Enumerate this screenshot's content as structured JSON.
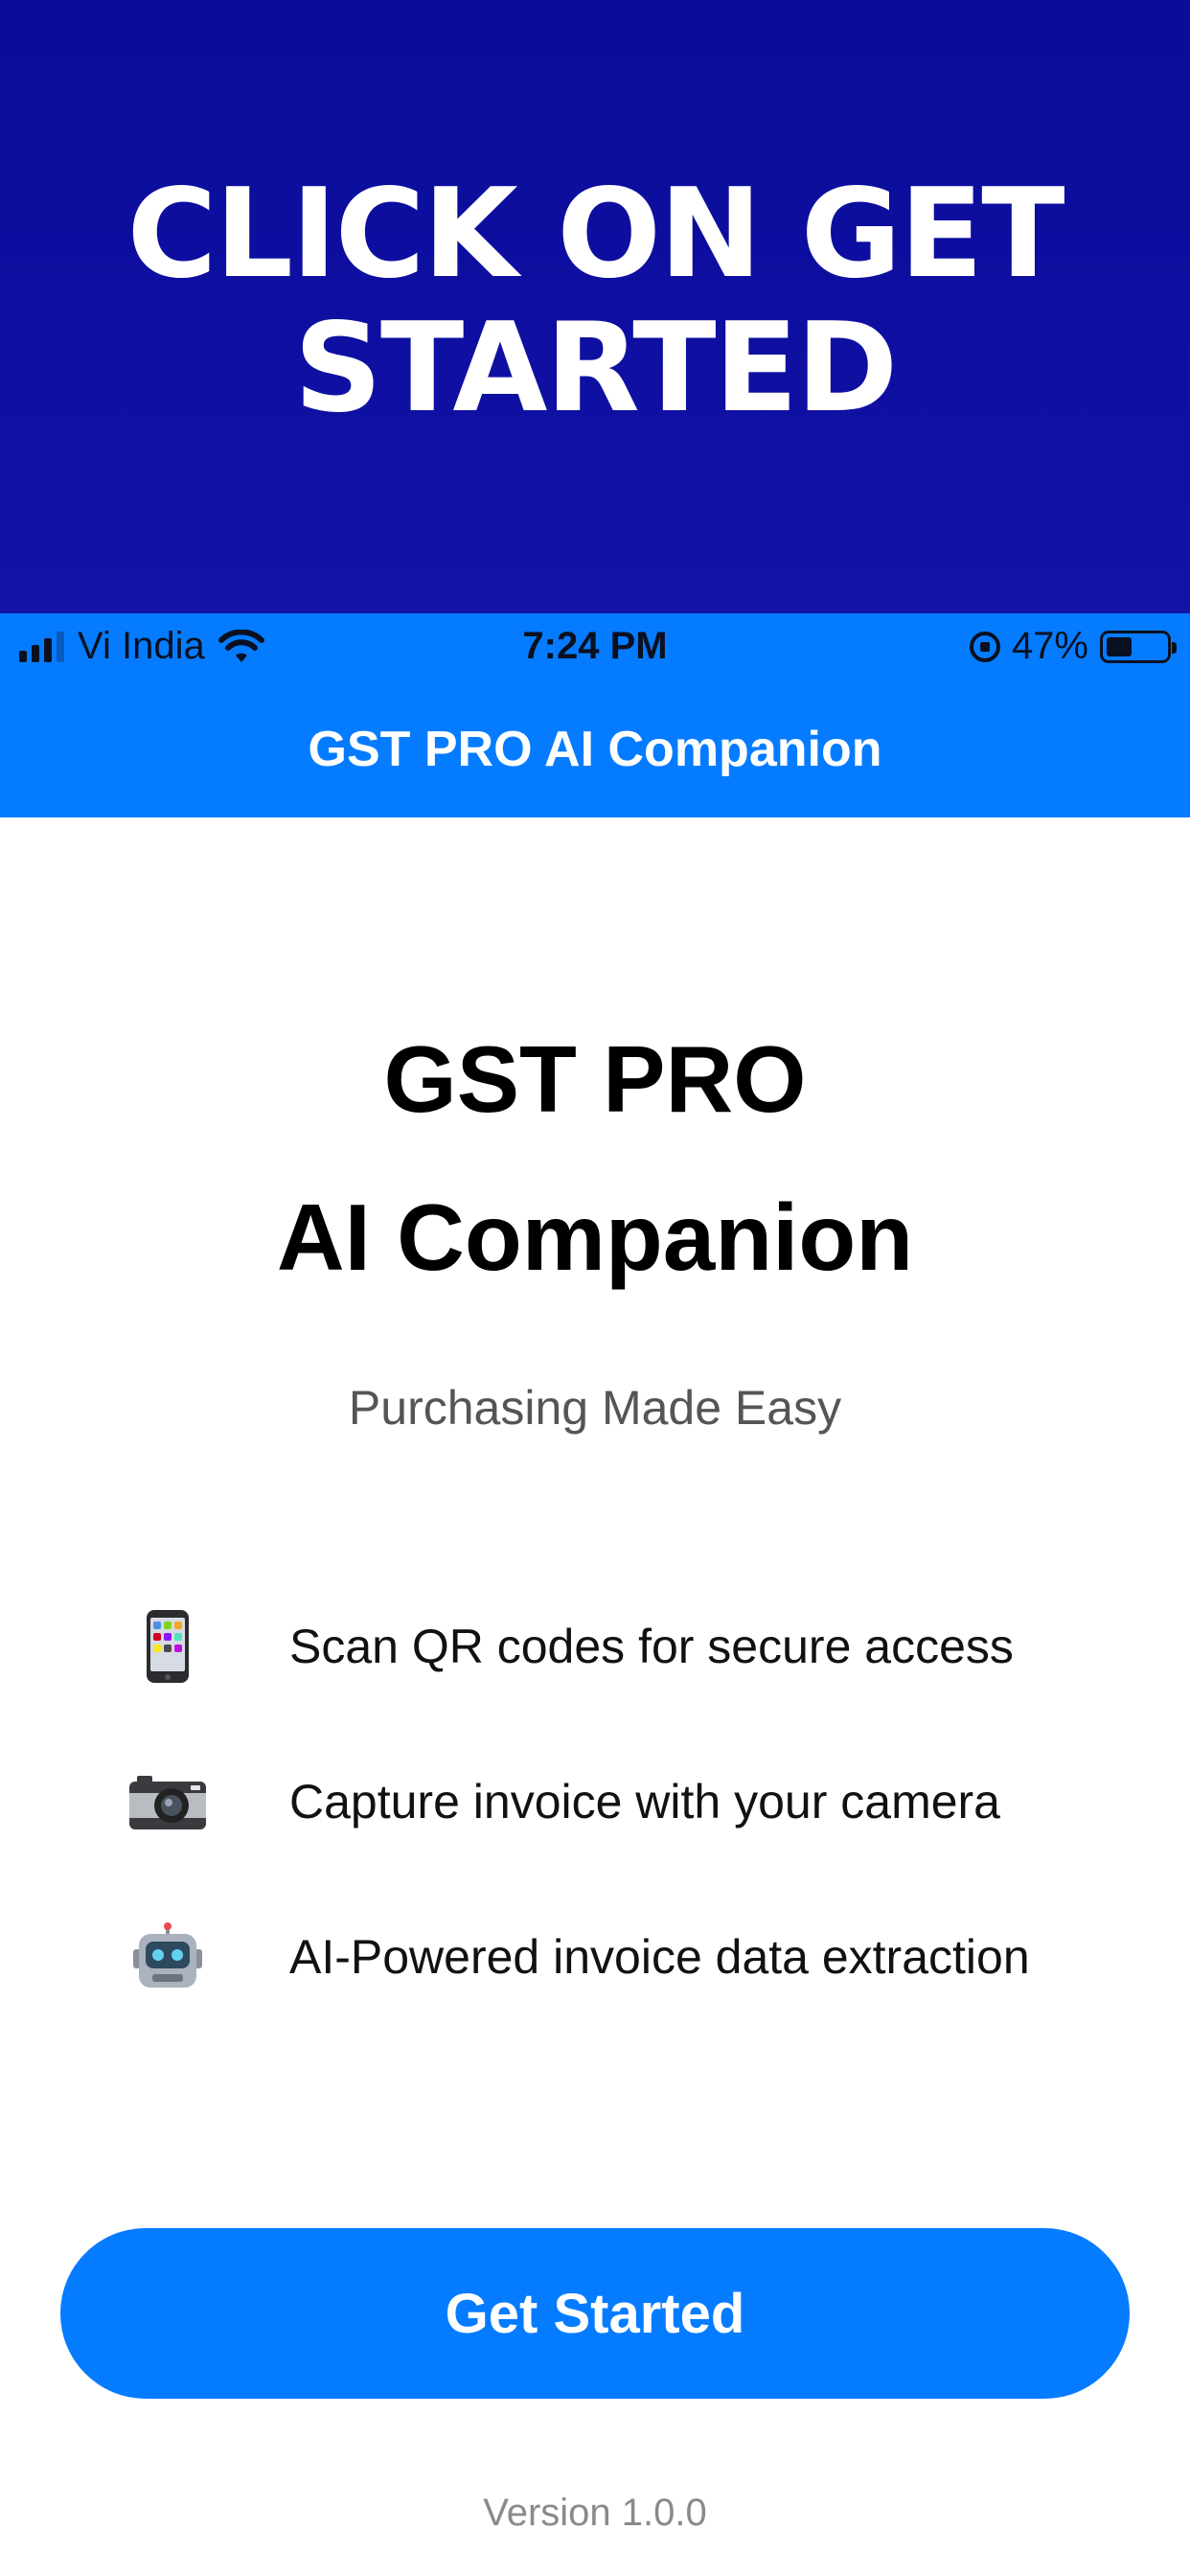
{
  "banner": {
    "text": "Click on Get Started"
  },
  "status_bar": {
    "carrier": "Vi India",
    "time": "7:24 PM",
    "battery": "47%",
    "battery_level": 0.47
  },
  "nav": {
    "title": "GST PRO AI Companion"
  },
  "hero": {
    "title_line1": "GST PRO",
    "title_line2": "AI Companion",
    "subtitle": "Purchasing Made Easy"
  },
  "features": [
    {
      "icon": "mobile-phone-icon",
      "text": "Scan QR codes for secure access"
    },
    {
      "icon": "camera-icon",
      "text": "Capture invoice with your camera"
    },
    {
      "icon": "robot-icon",
      "text": "AI-Powered invoice data extraction"
    }
  ],
  "cta": {
    "label": "Get Started"
  },
  "footer": {
    "version": "Version 1.0.0"
  },
  "colors": {
    "banner": "#0a0c9a",
    "accent": "#057cff",
    "text": "#000000",
    "subtitle": "#555555",
    "version": "#8a8a8a"
  }
}
